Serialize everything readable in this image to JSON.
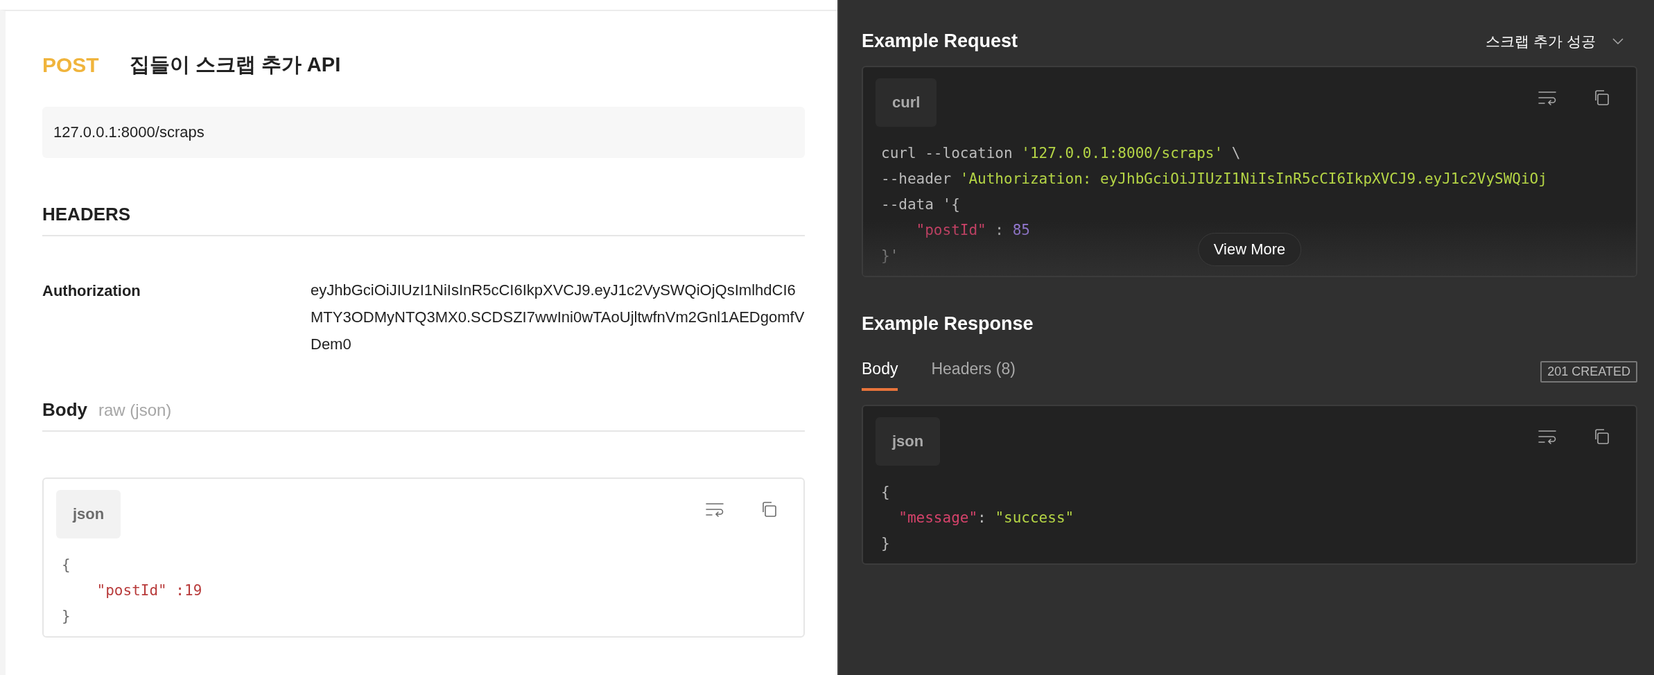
{
  "request": {
    "method": "POST",
    "title": "집들이 스크랩 추가 API",
    "url": "127.0.0.1:8000/scraps",
    "headers_title": "HEADERS",
    "headers": [
      {
        "name": "Authorization",
        "value": "eyJhbGciOiJIUzI1NiIsInR5cCI6IkpXVCJ9.eyJ1c2VySWQiOjQsImlhdCI6MTY3ODMyNTQ3MX0.SCDSZI7wwIni0wTAoUjltwfnVm2Gnl1AEDgomfVDem0"
      }
    ],
    "body_title": "Body",
    "body_mode": "raw (json)",
    "body_code": {
      "language": "json",
      "lines": [
        [
          {
            "kind": "punct",
            "text": "{"
          }
        ],
        [
          {
            "kind": "key",
            "text": "    \"postId\" :19"
          }
        ],
        [
          {
            "kind": "punct",
            "text": "}"
          }
        ]
      ]
    }
  },
  "example_request": {
    "title": "Example Request",
    "example_name": "스크랩 추가 성공",
    "code": {
      "language": "curl",
      "lines": [
        [
          {
            "kind": "plain",
            "text": "curl --location "
          },
          {
            "kind": "string",
            "text": "'127.0.0.1:8000/scraps'"
          },
          {
            "kind": "plain",
            "text": " \\"
          }
        ],
        [
          {
            "kind": "plain",
            "text": "--header "
          },
          {
            "kind": "string",
            "text": "'Authorization: eyJhbGciOiJIUzI1NiIsInR5cCI6IkpXVCJ9.eyJ1c2VySWQiOj"
          }
        ],
        [
          {
            "kind": "plain",
            "text": "--data '{"
          }
        ],
        [
          {
            "kind": "key",
            "text": "    \"postId\""
          },
          {
            "kind": "plain",
            "text": " : "
          },
          {
            "kind": "number",
            "text": "85"
          }
        ],
        [
          {
            "kind": "plain",
            "text": "}'"
          }
        ]
      ],
      "more_label": "View More"
    }
  },
  "example_response": {
    "title": "Example Response",
    "tabs": [
      {
        "label": "Body",
        "selected": true
      },
      {
        "label": "Headers (8)",
        "selected": false
      }
    ],
    "status": "201 CREATED",
    "code": {
      "language": "json",
      "lines": [
        [
          {
            "kind": "plain",
            "text": "{"
          }
        ],
        [
          {
            "kind": "key",
            "text": "  \"message\""
          },
          {
            "kind": "plain",
            "text": ": "
          },
          {
            "kind": "string",
            "text": "\"success\""
          }
        ],
        [
          {
            "kind": "plain",
            "text": "}"
          }
        ]
      ]
    }
  }
}
